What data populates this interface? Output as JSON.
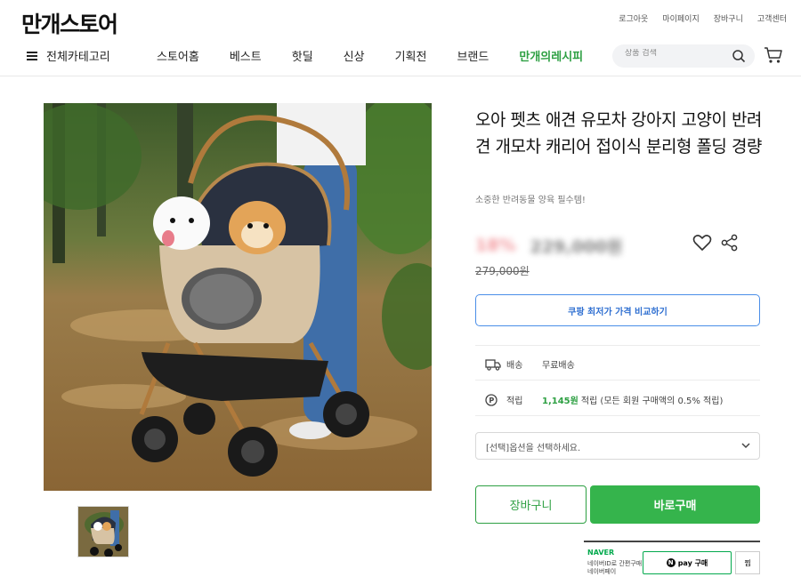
{
  "header": {
    "logo": "만개스토어",
    "util_links": [
      "로그아웃",
      "마이페이지",
      "장바구니",
      "고객센터"
    ],
    "category_label": "전체카테고리",
    "nav_items": [
      "스토어홈",
      "베스트",
      "핫딜",
      "신상",
      "기획전",
      "브랜드"
    ],
    "nav_highlight": "만개의레시피",
    "search_placeholder": "상품 검색"
  },
  "product": {
    "title": "오아 펫츠 애견 유모차 강아지 고양이 반려견 개모차 캐리어 접이식 분리형 폴딩 경량",
    "subtitle": "소중한 반려동물 양육 필수템!",
    "discount": "18%",
    "sale_price": "229,000원",
    "original_price": "279,000원",
    "compare_button": "쿠팡 최저가 가격 비교하기",
    "shipping_label": "배송",
    "shipping_value": "무료배송",
    "points_label": "적립",
    "points_value": "1,145원",
    "points_desc": "적립 (모든 회원 구매액의 0.5% 적립)",
    "option_placeholder": "[선택]옵션을 선택하세요.",
    "cart_button": "장바구니",
    "buy_button": "바로구매"
  },
  "naver_pay": {
    "logo": "NAVER",
    "line1": "네이버ID로 간편구매",
    "line2": "네이버페이",
    "pay_button": "pay 구매",
    "zzim_button": "찜"
  },
  "colors": {
    "brand_green": "#2ea043",
    "buy_green": "#35b44c",
    "compare_blue": "#4a8ee8",
    "naver_green": "#03a94d"
  }
}
